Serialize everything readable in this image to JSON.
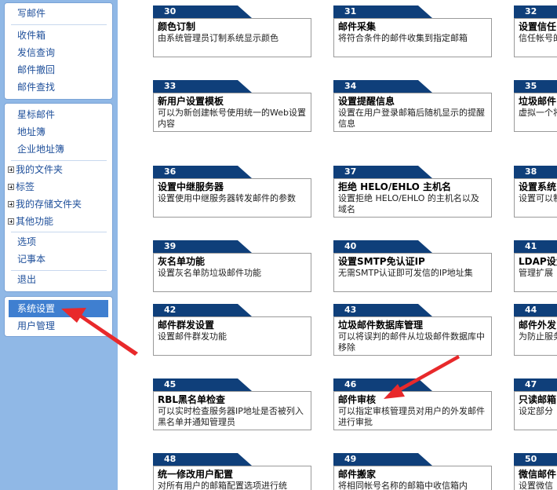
{
  "sidebar": {
    "group1": [
      "写邮件",
      "收件箱",
      "发信查询",
      "邮件撤回",
      "邮件查找"
    ],
    "group2": [
      "星标邮件",
      "地址簿",
      "企业地址簿"
    ],
    "folders": [
      "我的文件夹",
      "标签",
      "我的存储文件夹",
      "其他功能"
    ],
    "group3": [
      "选项",
      "记事本"
    ],
    "logout": "退出",
    "group4": [
      "系统设置",
      "用户管理"
    ]
  },
  "cards": [
    {
      "num": "30",
      "title": "颜色订制",
      "desc": "由系统管理员订制系统显示颜色"
    },
    {
      "num": "31",
      "title": "邮件采集",
      "desc": "将符合条件的邮件收集到指定邮箱"
    },
    {
      "num": "32",
      "title": "设置信任",
      "desc": "信任帐号的限制"
    },
    {
      "num": "33",
      "title": "新用户设置模板",
      "desc": "可以为新创建帐号使用统一的Web设置内容"
    },
    {
      "num": "34",
      "title": "设置提醒信息",
      "desc": "设置在用户登录邮箱后随机显示的提醒信息"
    },
    {
      "num": "35",
      "title": "垃圾邮件",
      "desc": "虚拟一个将所有发垃圾邮件"
    },
    {
      "num": "36",
      "title": "设置中继服务器",
      "desc": "设置使用中继服务器转发邮件的参数"
    },
    {
      "num": "37",
      "title": "拒绝 HELO/EHLO 主机名",
      "desc": "设置拒绝 HELO/EHLO 的主机名以及域名"
    },
    {
      "num": "38",
      "title": "设置系统",
      "desc": "设置可以制节日信"
    },
    {
      "num": "39",
      "title": "灰名单功能",
      "desc": "设置灰名单防垃圾邮件功能"
    },
    {
      "num": "40",
      "title": "设置SMTP免认证IP",
      "desc": "无需SMTP认证即可发信的IP地址集"
    },
    {
      "num": "41",
      "title": "LDAP设置",
      "desc": "管理扩展"
    },
    {
      "num": "42",
      "title": "邮件群发设置",
      "desc": "设置邮件群发功能"
    },
    {
      "num": "43",
      "title": "垃圾邮件数据库管理",
      "desc": "可以将误判的邮件从垃圾邮件数据库中移除"
    },
    {
      "num": "44",
      "title": "邮件外发",
      "desc": "为防止服务需要对用户"
    },
    {
      "num": "45",
      "title": "RBL黑名单检查",
      "desc": "可以实时检查服务器IP地址是否被列入黑名单并通知管理员"
    },
    {
      "num": "46",
      "title": "邮件审核",
      "desc": "可以指定审核管理员对用户的外发邮件进行审批"
    },
    {
      "num": "47",
      "title": "只读邮箱",
      "desc": "设定部分"
    },
    {
      "num": "48",
      "title": "统一修改用户配置",
      "desc": "对所有用户的邮箱配置选项进行统"
    },
    {
      "num": "49",
      "title": "邮件搬家",
      "desc": "将相同帐号名称的邮箱中收信箱内"
    },
    {
      "num": "50",
      "title": "微信邮件",
      "desc": "设置微信"
    }
  ],
  "colors": {
    "sidebar_bg": "#90b8e6",
    "tab_bg": "#0f3f7a",
    "selected_bg": "#3f7fd0",
    "arrow": "#e8292b"
  }
}
